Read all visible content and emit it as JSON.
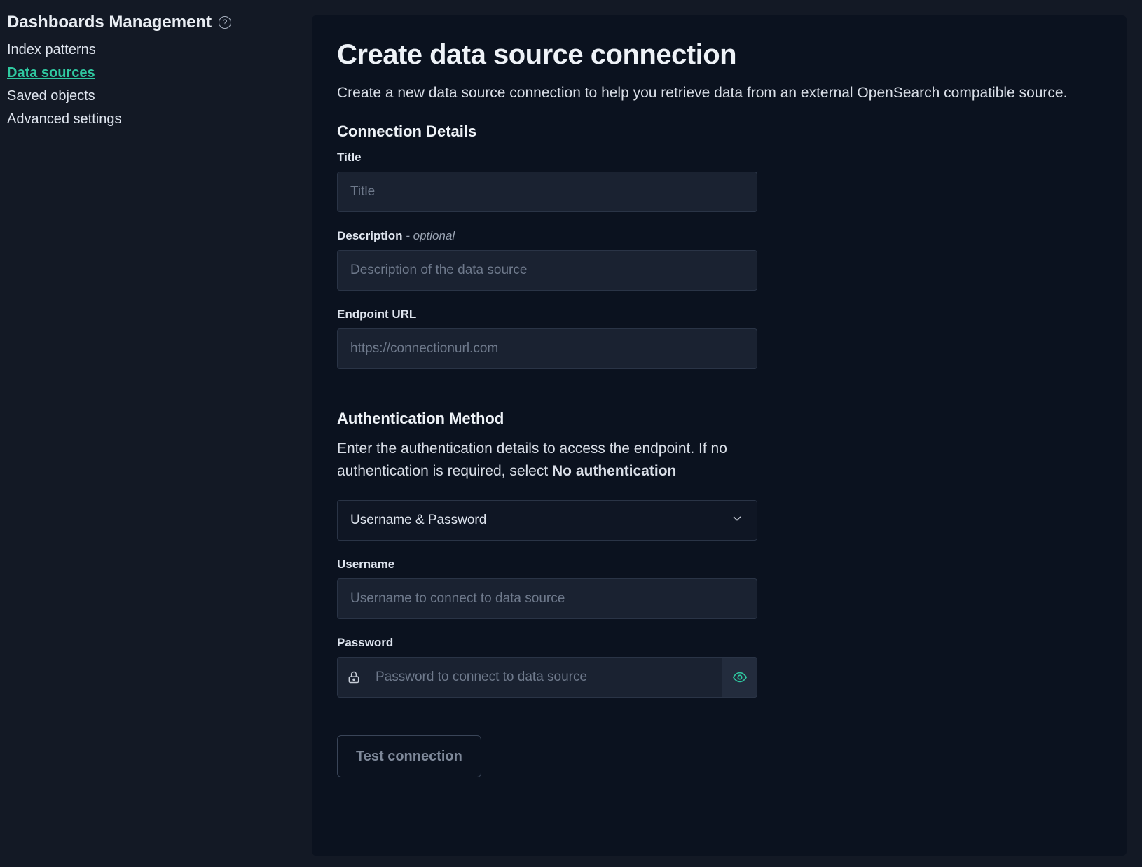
{
  "sidebar": {
    "title": "Dashboards Management",
    "items": [
      {
        "label": "Index patterns"
      },
      {
        "label": "Data sources"
      },
      {
        "label": "Saved objects"
      },
      {
        "label": "Advanced settings"
      }
    ],
    "active_index": 1
  },
  "page": {
    "title": "Create data source connection",
    "subtitle": "Create a new data source connection to help you retrieve data from an external OpenSearch compatible source."
  },
  "connection": {
    "section_title": "Connection Details",
    "title_label": "Title",
    "title_placeholder": "Title",
    "title_value": "",
    "description_label": "Description",
    "description_optional": " - optional",
    "description_placeholder": "Description of the data source",
    "description_value": "",
    "endpoint_label": "Endpoint URL",
    "endpoint_placeholder": "https://connectionurl.com",
    "endpoint_value": ""
  },
  "auth": {
    "section_title": "Authentication Method",
    "desc_prefix": "Enter the authentication details to access the endpoint. If no authentication is required, select ",
    "desc_bold": "No authentication",
    "method_selected": "Username & Password",
    "username_label": "Username",
    "username_placeholder": "Username to connect to data source",
    "username_value": "",
    "password_label": "Password",
    "password_placeholder": "Password to connect to data source",
    "password_value": ""
  },
  "actions": {
    "test_connection": "Test connection"
  }
}
